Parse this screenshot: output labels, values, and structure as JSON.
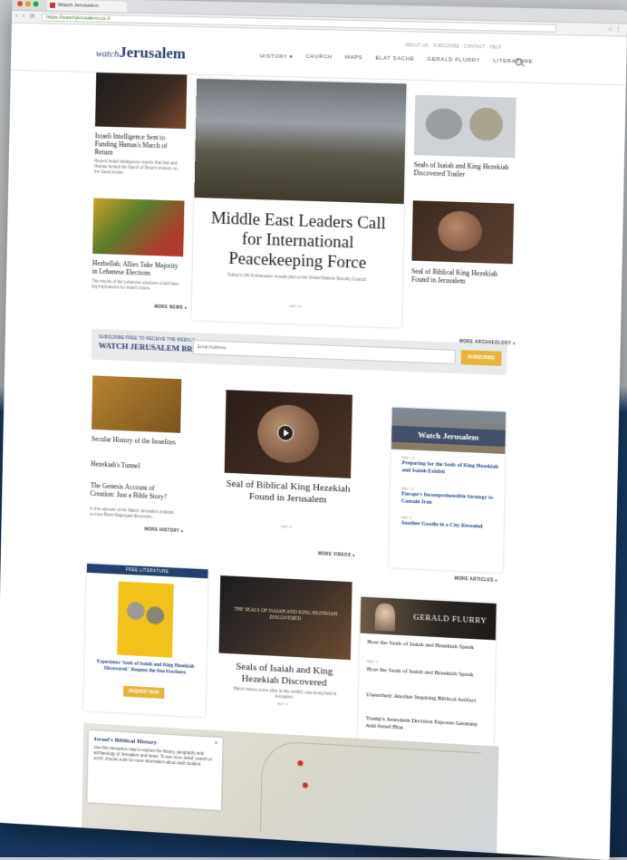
{
  "browser": {
    "tab_title": "Watch Jerusalem",
    "url": "https://watchjerusalem.co.il"
  },
  "header": {
    "logo_small": "watch",
    "logo_big": "Jerusalem",
    "logo_tag": "",
    "nav": [
      "HISTORY ▾",
      "CHURCH",
      "MAPS",
      "ELAT SACHE",
      "GERALD FLURRY",
      "LITERATURE"
    ],
    "utility": "ABOUT US · SUBSCRIBE · CONTACT · HELP"
  },
  "top": {
    "left1": {
      "title": "Israeli Intelligence Sent to Funding Hamas's March of Return",
      "summary": "Recent Israeli intelligence reports that Iran and Hamas funded the March of Return protests on the Gaza border."
    },
    "left2": {
      "title": "Hezbollah, Allies Take Majority in Lebanese Elections",
      "summary": "The results of the Lebanese elections could have big implications for Israel's future."
    },
    "see_more_left": "MORE NEWS »",
    "feature": {
      "title": "Middle East Leaders Call for International Peacekeeping Force",
      "summary": "Turkey's UN Ambassador reveals plan to the United Nations Security Council.",
      "date": "MAY 16"
    },
    "right1": {
      "title": "Seals of Isaiah and King Hezekiah Discovered Trailer"
    },
    "right2": {
      "title": "Seal of Biblical King Hezekiah Found in Jerusalem"
    },
    "see_more_right": "MORE ARCHAEOLOGY »"
  },
  "newsletter": {
    "label_top": "SUBSCRIBE FREE TO RECEIVE THE WEEKLY",
    "label_main": "WATCH JERUSALEM BRIEF",
    "placeholder": "Email Address",
    "button": "SUBSCRIBE"
  },
  "mid": {
    "left_items": [
      "Secular History of the Israelites",
      "Hezekiah's Tunnel",
      "The Genesis Account of Creation: Just a Bible Story?"
    ],
    "left_summary": "In this episode of the Watch Jerusalem podcast, co-host Brent Nagtegaal discusses...",
    "see_more_left": "MORE HISTORY »",
    "video": {
      "title": "Seal of Biblical King Hezekiah Found in Jerusalem",
      "date": "MAY 8"
    },
    "see_more_mid": "MORE VIDEOS »",
    "magazine_label": "Watch Jerusalem",
    "right_items": [
      {
        "date": "MAY 14",
        "title": "Preparing for the Seals of King Hezekiah and Isaiah Exhibit"
      },
      {
        "date": "MAY 10",
        "title": "Europe's Incomprehensible Strategy to Contain Iran"
      },
      {
        "date": "MAY 4",
        "title": "Another Goodie in a City Revealed"
      }
    ],
    "see_more_right": "MORE ARTICLES »"
  },
  "bottom": {
    "promo": {
      "banner": "FREE LITERATURE",
      "title": "Experience 'Seals of Isaiah and King Hezekiah Discovered.' Request the free brochure.",
      "button": "REQUEST NOW"
    },
    "center": {
      "title": "Seals of Isaiah and King Hezekiah Discovered",
      "summary": "Watch history come alive in this exhibit, now being held in Jerusalem.",
      "date": "MAY 8",
      "image_caption": "THE SEALS OF ISAIAH AND KING HEZEKIAH DISCOVERED"
    },
    "flurry": {
      "banner": "GERALD FLURRY",
      "items": [
        "How the Seals of Isaiah and Hezekiah Speak",
        "How the Seals of Isaiah and Hezekiah Speak",
        "Unearthed: Another Inspiring Biblical Artifact",
        "Trump's Jerusalem Decision Exposes Germany Anti-Israel Bias"
      ],
      "date": "MAY 3"
    }
  },
  "map": {
    "title": "Israel's Biblical History",
    "text": "Use this interactive map to explore the history, geography and archaeology of Jerusalem and Israel. To see more detail, search or scroll, choose a pin for more information about each location.",
    "close": "×"
  }
}
